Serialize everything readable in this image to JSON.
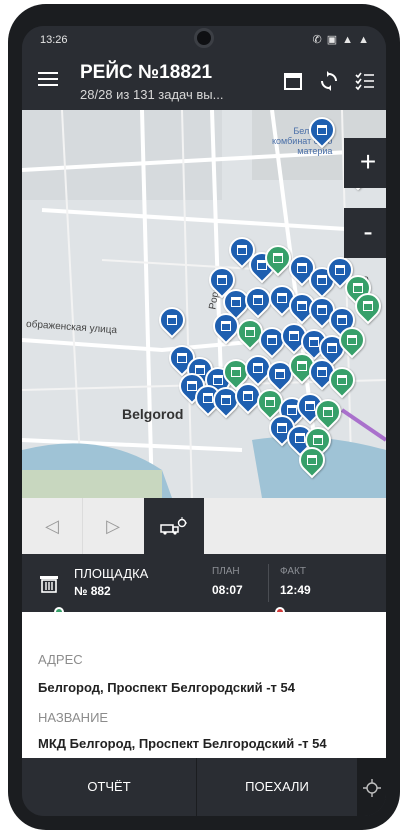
{
  "status": {
    "time": "13:26",
    "icons": "✆ ▣ ▲ ▲"
  },
  "header": {
    "title": "РЕЙС №18821",
    "subtitle": "28/28 из 131 задач вы..."
  },
  "map": {
    "city": "Belgorod",
    "street_1": "Popov St",
    "street_2": "ображенская улица",
    "poi": "Белгород\nкомбинат стро\nматериа",
    "side_label": "ино",
    "zoom_in": "+",
    "zoom_out": "-",
    "marker_colors": {
      "blue": "#1e5fb0",
      "green": "#37a06a"
    }
  },
  "tabs": {
    "prev": "◁",
    "next": "▷"
  },
  "site": {
    "title": "ПЛОЩАДКА",
    "number": "№ 882",
    "plan_label": "ПЛАН",
    "plan_value": "08:07",
    "fact_label": "ФАКТ",
    "fact_value": "12:49",
    "dot_green": "#37a06a",
    "dot_red": "#d23a3a"
  },
  "details": {
    "address_label": "АДРЕС",
    "address_value": "Белгород, Проспект Белгородский -т 54",
    "name_label": "НАЗВАНИЕ",
    "name_value": "МКД Белгород, Проспект Белгородский -т 54"
  },
  "bottom": {
    "report_label": "ОТЧЁТ",
    "go_label": "ПОЕХАЛИ"
  }
}
